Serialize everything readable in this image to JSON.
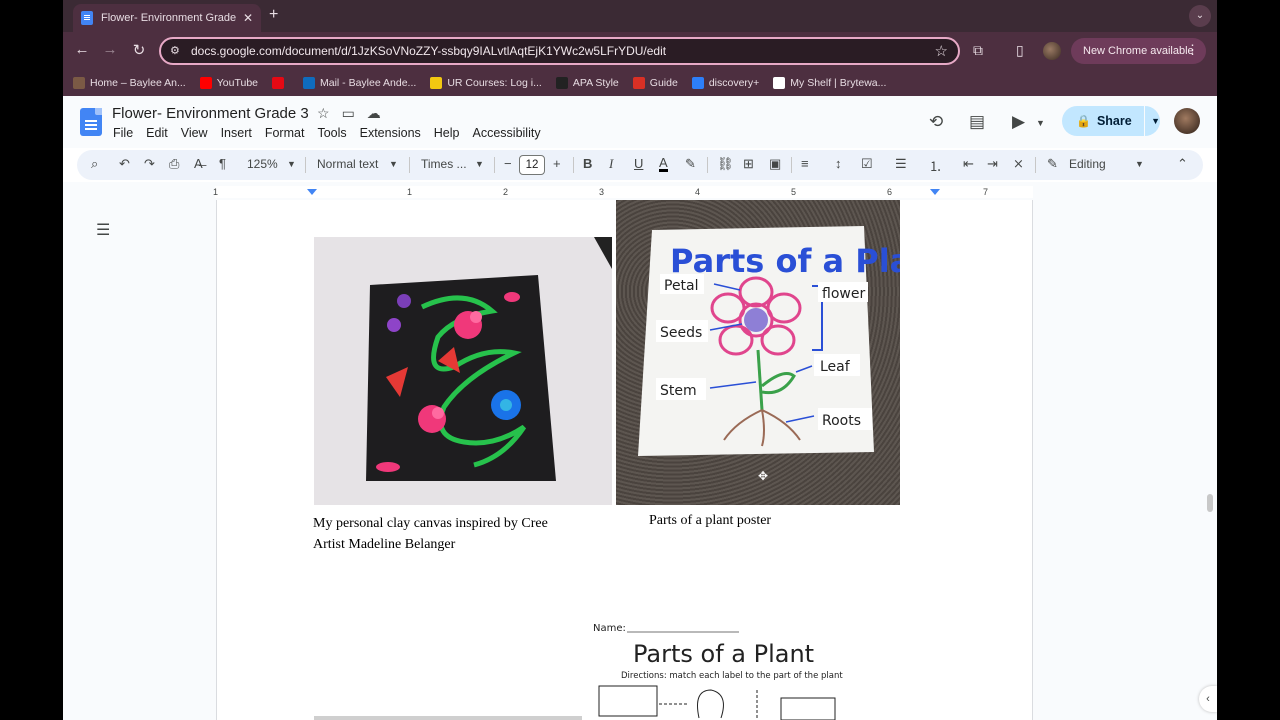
{
  "browser": {
    "tab_title": "Flower- Environment Grade 3",
    "url": "docs.google.com/document/d/1JzKSoVNoZZY-ssbqy9IALvtlAqtEjK1YWc2w5LFrYDU/edit",
    "new_chrome_label": "New Chrome available",
    "bookmarks": [
      {
        "label": "Home – Baylee An...",
        "color": "#7b5a45"
      },
      {
        "label": "YouTube",
        "color": "#ff0000"
      },
      {
        "label": "",
        "color": "#e50914"
      },
      {
        "label": "Mail - Baylee Ande...",
        "color": "#0f6cbd"
      },
      {
        "label": "UR Courses: Log i...",
        "color": "#f2c811"
      },
      {
        "label": "APA Style",
        "color": "#222222"
      },
      {
        "label": "Guide",
        "color": "#d93025"
      },
      {
        "label": "discovery+",
        "color": "#2d7ff9"
      },
      {
        "label": "My Shelf | Brytewa...",
        "color": "#ffffff"
      }
    ]
  },
  "docs": {
    "title": "Flower- Environment Grade 3",
    "menu": [
      "File",
      "Edit",
      "View",
      "Insert",
      "Format",
      "Tools",
      "Extensions",
      "Help",
      "Accessibility"
    ],
    "share_label": "Share",
    "toolbar": {
      "zoom": "125%",
      "style": "Normal text",
      "font": "Times ...",
      "font_size": "12",
      "mode": "Editing"
    },
    "ruler_ticks": [
      "1",
      "1",
      "2",
      "3",
      "4",
      "5",
      "6",
      "7"
    ]
  },
  "content": {
    "caption_left": "My personal clay canvas inspired by Cree Artist Madeline Belanger",
    "caption_right": "Parts of a plant poster",
    "poster": {
      "title": "Parts of a Plant",
      "labels": [
        "Petal",
        "flower",
        "Seeds",
        "Leaf",
        "Stem",
        "Roots"
      ]
    },
    "worksheet": {
      "name_label": "Name:",
      "title": "Parts of a Plant",
      "directions": "Directions: match each label to the part of the plant"
    }
  },
  "colors": {
    "accent": "#c2e7ff",
    "chrome_frame": "#4d2f40"
  }
}
